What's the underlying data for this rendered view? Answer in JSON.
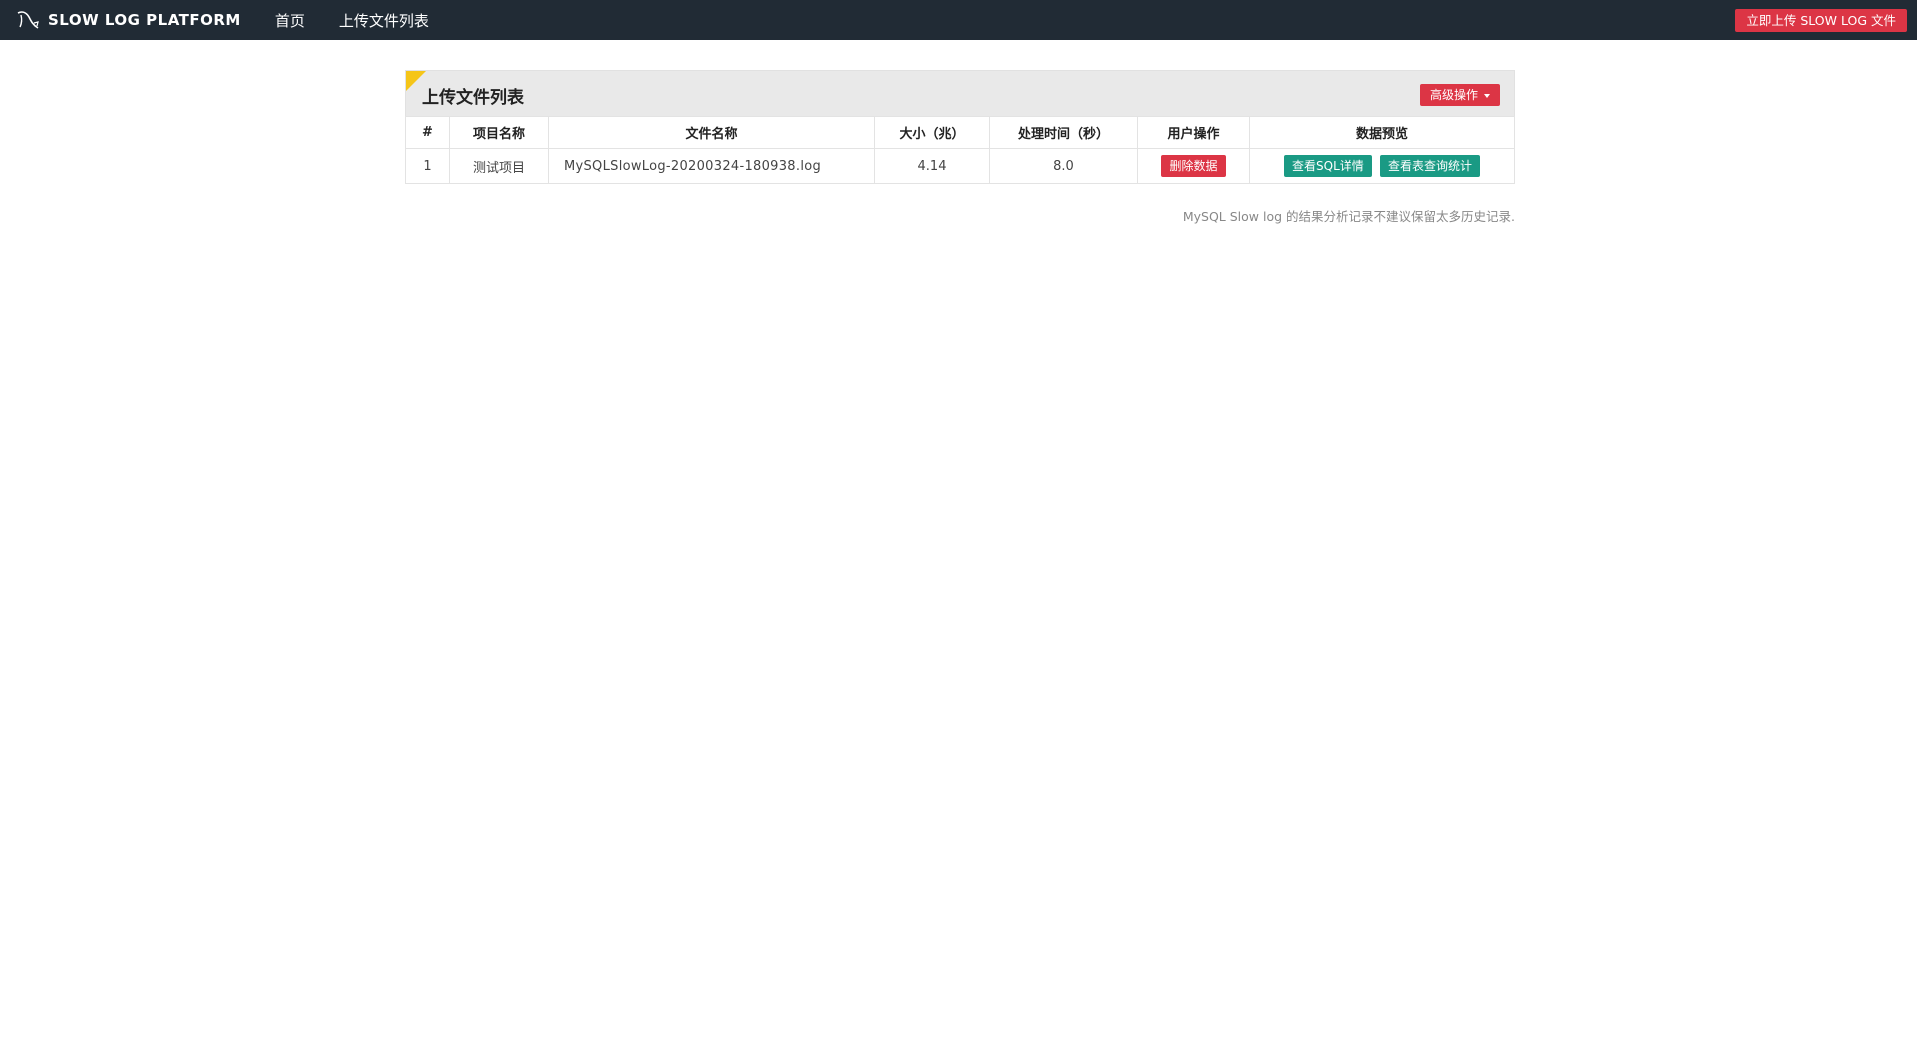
{
  "navbar": {
    "brand": "SLOW LOG PLATFORM",
    "brand_icon": "mysql-dolphin-icon",
    "links": [
      "首页",
      "上传文件列表"
    ],
    "upload_button": "立即上传 SLOW LOG 文件"
  },
  "panel": {
    "title": "上传文件列表",
    "advanced_button": "高级操作",
    "columns": [
      "#",
      "项目名称",
      "文件名称",
      "大小（兆）",
      "处理时间（秒）",
      "用户操作",
      "数据预览"
    ],
    "rows": [
      {
        "index": "1",
        "project": "测试项目",
        "file": "MySQLSlowLog-20200324-180938.log",
        "size": "4.14",
        "time": "8.0",
        "delete_label": "删除数据",
        "sql_detail_label": "查看SQL详情",
        "table_stats_label": "查看表查询统计"
      }
    ]
  },
  "footnote": "MySQL Slow log 的结果分析记录不建议保留太多历史记录.",
  "colors": {
    "navbar_bg": "#212b35",
    "danger": "#dc3545",
    "teal": "#1a9a84",
    "accent_corner": "#f5c518"
  }
}
